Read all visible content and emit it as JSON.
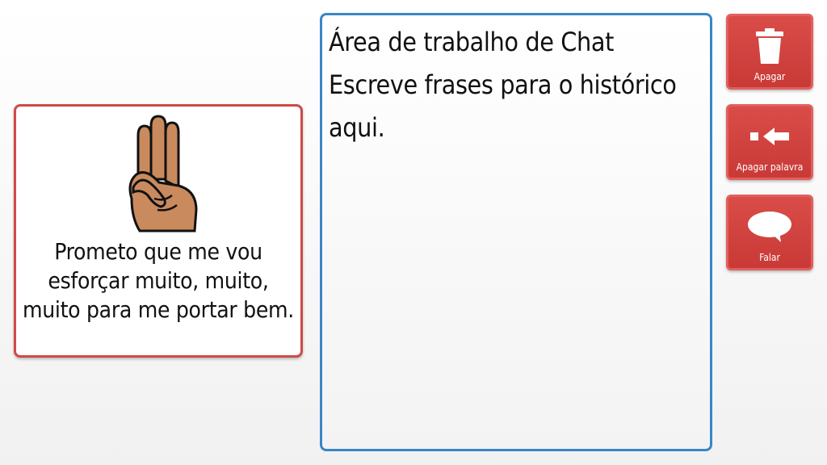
{
  "symbol_card": {
    "icon": "three-fingers-hand-icon",
    "caption": "Prometo que me vou esforçar muito, muito, muito para me portar bem."
  },
  "chat": {
    "line1": "Área de trabalho de Chat",
    "line2": "Escreve frases para o histórico",
    "line3": "aqui."
  },
  "buttons": {
    "delete": {
      "label": "Apagar",
      "icon": "trash-icon"
    },
    "delete_word": {
      "label": "Apagar palavra",
      "icon": "backspace-arrow-icon"
    },
    "speak": {
      "label": "Falar",
      "icon": "speech-bubble-icon"
    }
  },
  "colors": {
    "card_border": "#cf4a46",
    "chat_border": "#3a86c6",
    "button_bg": "#d94c48"
  }
}
